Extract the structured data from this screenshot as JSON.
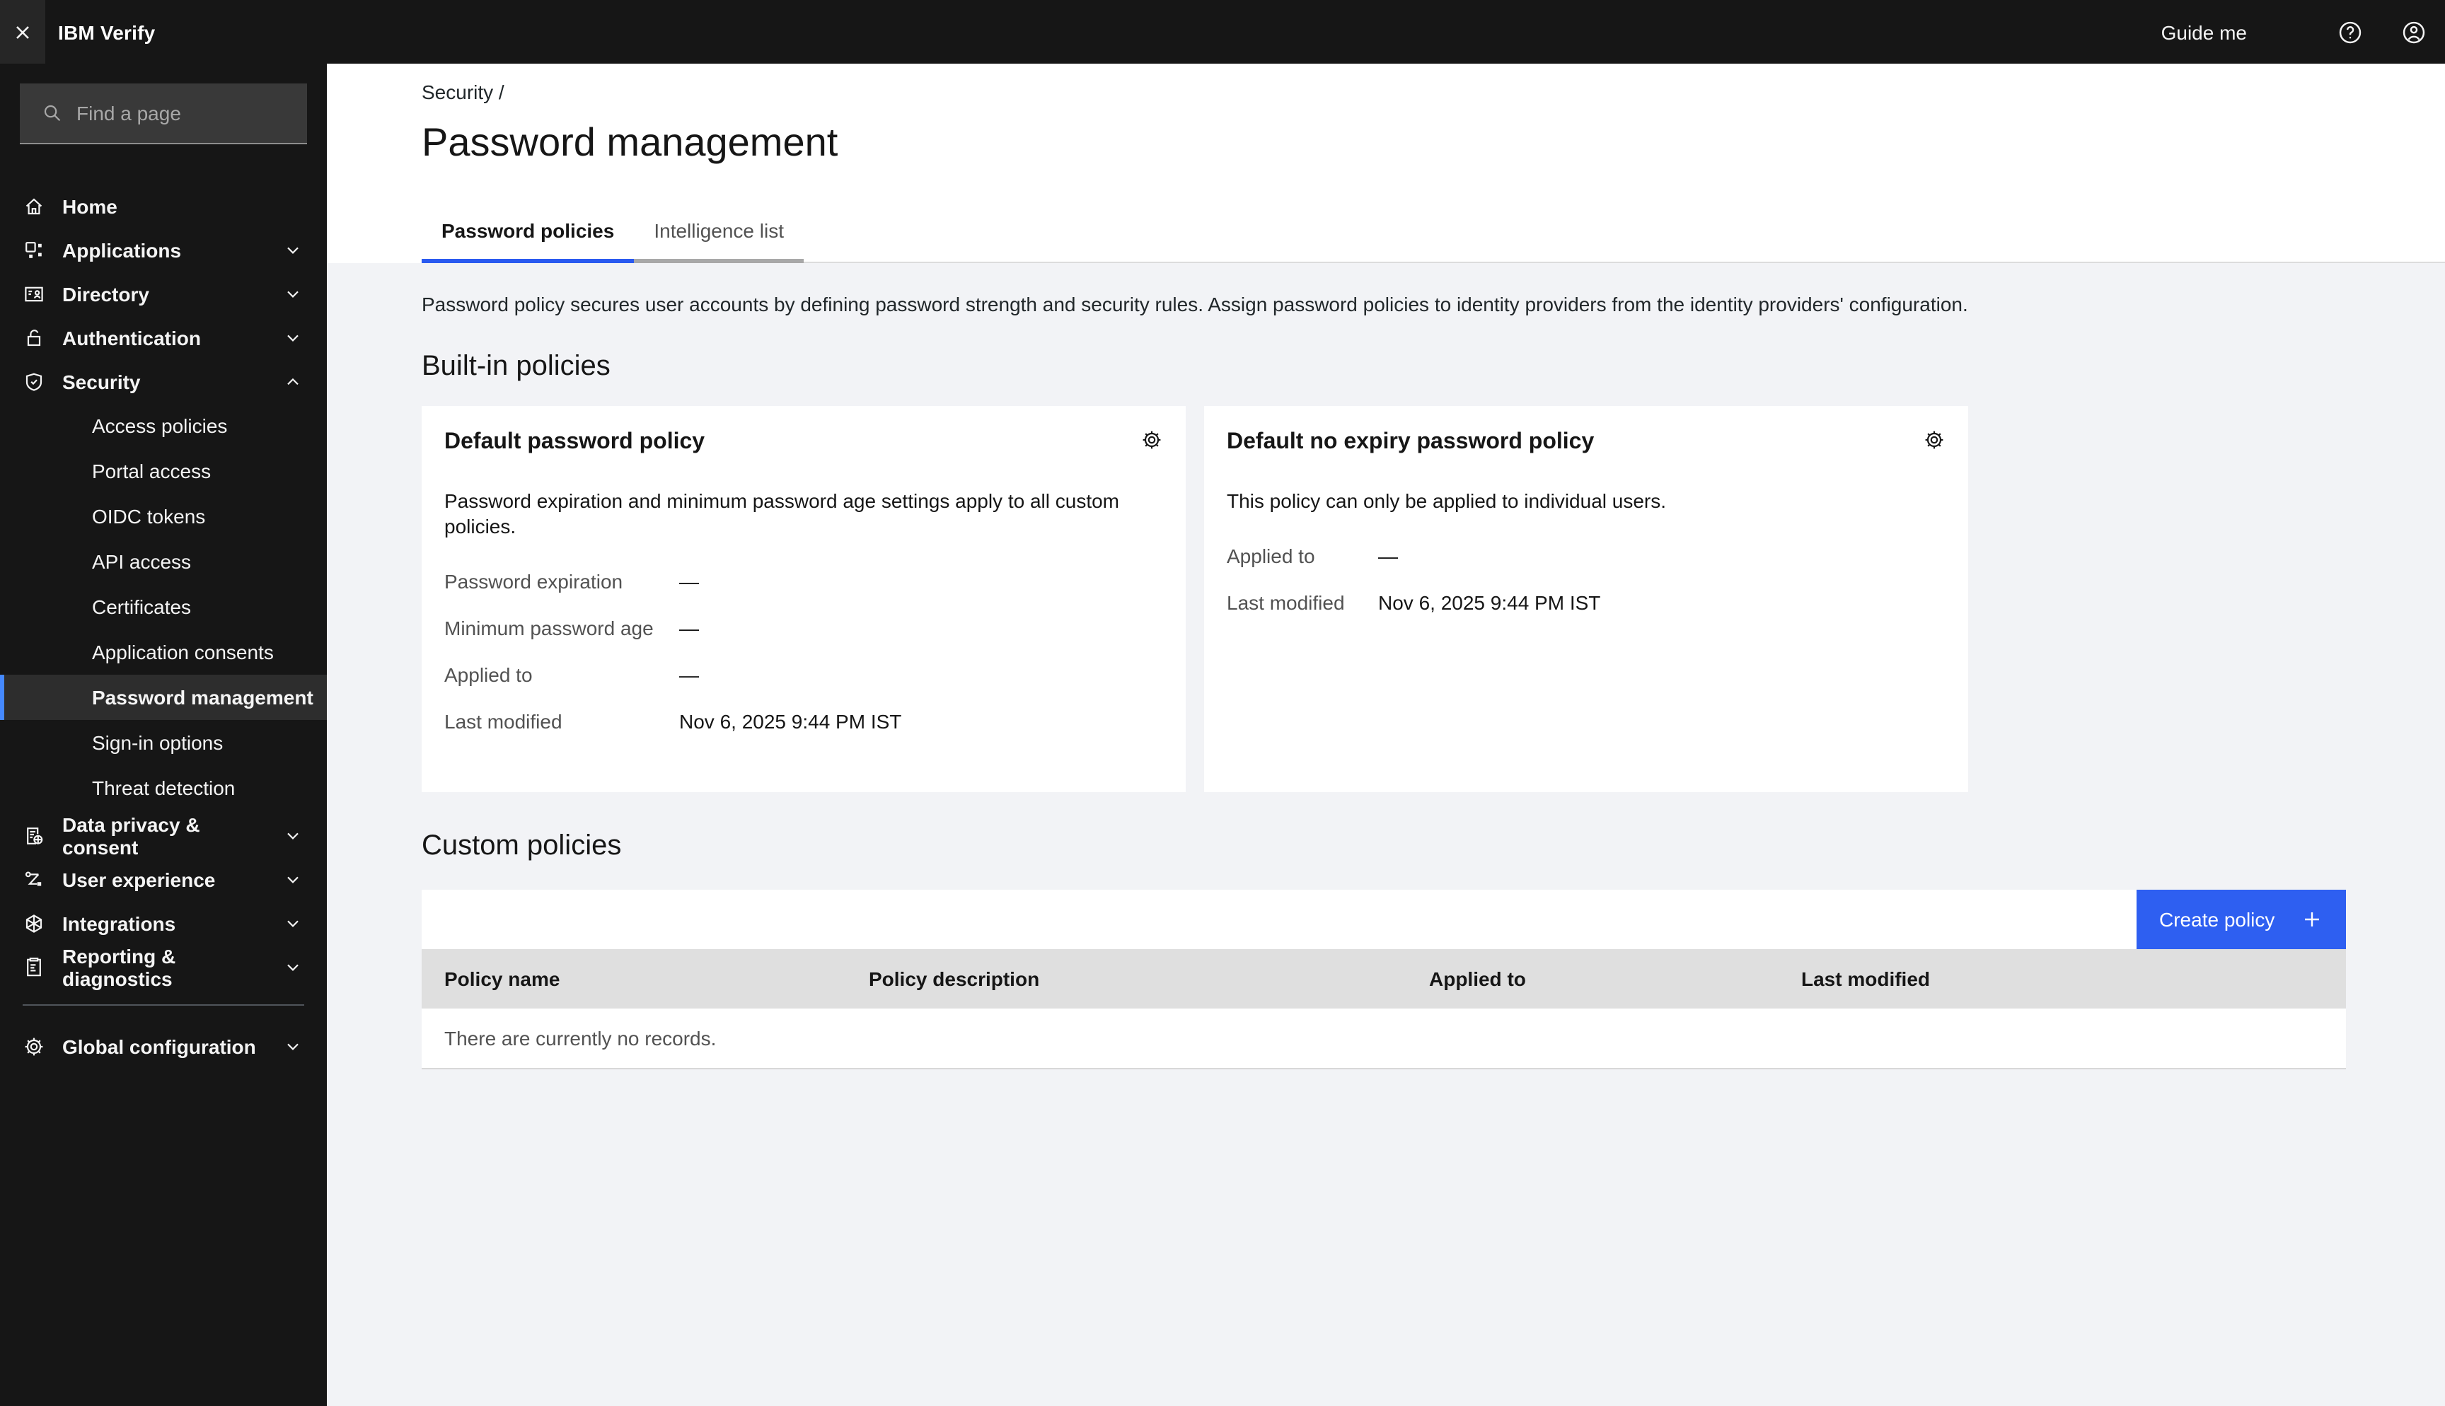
{
  "header": {
    "brand": "IBM Verify",
    "guide_me_label": "Guide me"
  },
  "sidebar": {
    "search_placeholder": "Find a page",
    "items": [
      {
        "label": "Home",
        "icon": "home-icon"
      },
      {
        "label": "Applications",
        "icon": "applications-icon"
      },
      {
        "label": "Directory",
        "icon": "directory-icon"
      },
      {
        "label": "Authentication",
        "icon": "authentication-icon"
      },
      {
        "label": "Security",
        "icon": "security-icon",
        "expanded": true
      }
    ],
    "security_subitems": [
      "Access policies",
      "Portal access",
      "OIDC tokens",
      "API access",
      "Certificates",
      "Application consents",
      "Password management",
      "Sign-in options",
      "Threat detection"
    ],
    "selected_subitem": "Password management",
    "lower_items": [
      {
        "label": "Data privacy & consent",
        "icon": "data-privacy-icon"
      },
      {
        "label": "User experience",
        "icon": "user-experience-icon"
      },
      {
        "label": "Integrations",
        "icon": "integrations-icon"
      },
      {
        "label": "Reporting & diagnostics",
        "icon": "reporting-icon"
      }
    ],
    "global_item": {
      "label": "Global configuration",
      "icon": "gear-icon"
    }
  },
  "page": {
    "breadcrumb": "Security /",
    "title": "Password management",
    "tabs": [
      {
        "label": "Password policies",
        "active": true
      },
      {
        "label": "Intelligence list",
        "active": false
      }
    ],
    "description": "Password policy secures user accounts by defining password strength and security rules. Assign password policies to identity providers from the identity providers' configuration.",
    "builtin": {
      "heading": "Built-in policies",
      "cards": [
        {
          "title": "Default password policy",
          "body": "Password expiration and minimum password age settings apply to all custom policies.",
          "rows": [
            {
              "label": "Password expiration",
              "value": "—"
            },
            {
              "label": "Minimum password age",
              "value": "—"
            },
            {
              "label": "Applied to",
              "value": "—"
            },
            {
              "label": "Last modified",
              "value": "Nov 6, 2025 9:44 PM IST"
            }
          ]
        },
        {
          "title": "Default no expiry password policy",
          "body": "This policy can only be applied to individual users.",
          "rows": [
            {
              "label": "Applied to",
              "value": "—"
            },
            {
              "label": "Last modified",
              "value": "Nov 6, 2025 9:44 PM IST"
            }
          ]
        }
      ]
    },
    "custom": {
      "heading": "Custom policies",
      "create_button": "Create policy",
      "columns": [
        "Policy name",
        "Policy description",
        "Applied to",
        "Last modified"
      ],
      "empty_message": "There are currently no records."
    }
  },
  "colors": {
    "header_bg": "#161616",
    "accent_blue": "#2e5ff1",
    "sidebar_selected_accent": "#4589ff",
    "table_header_bg": "#dfdfdf",
    "page_bg": "#f2f3f6"
  }
}
